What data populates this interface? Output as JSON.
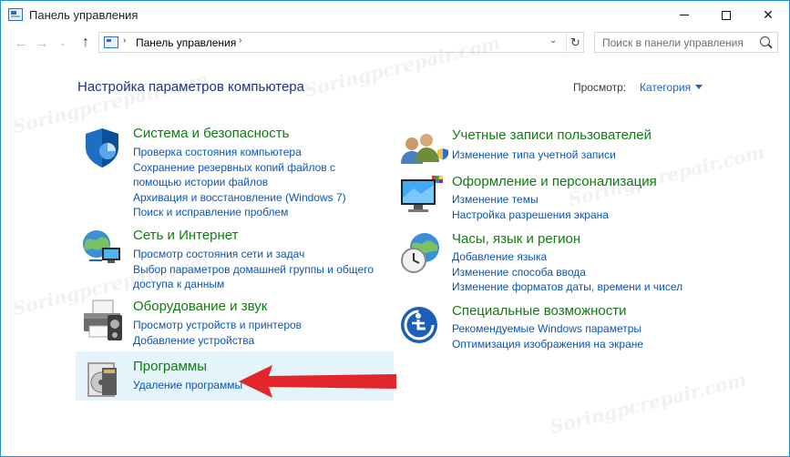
{
  "window": {
    "title": "Панель управления"
  },
  "titlebar": {
    "minimize_icon": "minimize-icon",
    "maximize_icon": "maximize-icon",
    "close_label": "✕"
  },
  "nav": {
    "back": "←",
    "forward": "→",
    "recent": "⌄",
    "up": "↑",
    "address_separator": "›",
    "address_path": "Панель управления",
    "address_chevron_after": "›",
    "address_dropdown": "⌄",
    "refresh": "↻",
    "search_placeholder": "Поиск в панели управления"
  },
  "main": {
    "title": "Настройка параметров компьютера",
    "view_label": "Просмотр:",
    "view_value": "Категория"
  },
  "categories_left": [
    {
      "icon": "shield-icon",
      "heading": "Система и безопасность",
      "links": [
        "Проверка состояния компьютера",
        "Сохранение резервных копий файлов с помощью истории файлов",
        "Архивация и восстановление (Windows 7)",
        "Поиск и исправление проблем"
      ]
    },
    {
      "icon": "network-globe-icon",
      "heading": "Сеть и Интернет",
      "links": [
        "Просмотр состояния сети и задач",
        "Выбор параметров домашней группы и общего доступа к данным"
      ]
    },
    {
      "icon": "printer-icon",
      "heading": "Оборудование и звук",
      "links": [
        "Просмотр устройств и принтеров",
        "Добавление устройства"
      ]
    },
    {
      "icon": "programs-disc-icon",
      "heading": "Программы",
      "links": [
        "Удаление программы"
      ]
    }
  ],
  "categories_right": [
    {
      "icon": "users-icon",
      "heading": "Учетные записи пользователей",
      "links": [
        "Изменение типа учетной записи"
      ]
    },
    {
      "icon": "display-icon",
      "heading": "Оформление и персонализация",
      "links": [
        "Изменение темы",
        "Настройка разрешения экрана"
      ]
    },
    {
      "icon": "clock-globe-icon",
      "heading": "Часы, язык и регион",
      "links": [
        "Добавление языка",
        "Изменение способа ввода",
        "Изменение форматов даты, времени и чисел"
      ]
    },
    {
      "icon": "accessibility-icon",
      "heading": "Специальные возможности",
      "links": [
        "Рекомендуемые Windows параметры",
        "Оптимизация изображения на экране"
      ]
    }
  ],
  "annotation": {
    "arrow_color": "#e3262b"
  },
  "watermark": {
    "text": "Soringpcrepair.com"
  },
  "colors": {
    "accent_border": "#1a8fd8",
    "heading_green": "#107c10",
    "link_blue": "#0b55b5",
    "title_blue": "#1e3287",
    "highlight_bg": "#e5f3fb"
  }
}
